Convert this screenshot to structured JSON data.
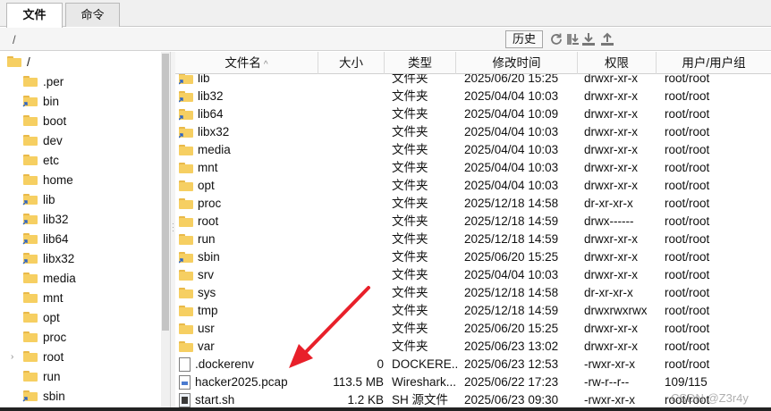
{
  "tabs": [
    {
      "label": "文件",
      "active": true
    },
    {
      "label": "命令",
      "active": false
    }
  ],
  "path": {
    "value": "/"
  },
  "toolbar": {
    "history_label": "历史",
    "icons": [
      "refresh-icon",
      "download-icon",
      "upload-icon"
    ]
  },
  "tree": {
    "root_label": "/",
    "items": [
      {
        "label": ".per"
      },
      {
        "label": "bin",
        "link": true
      },
      {
        "label": "boot"
      },
      {
        "label": "dev"
      },
      {
        "label": "etc"
      },
      {
        "label": "home"
      },
      {
        "label": "lib",
        "link": true
      },
      {
        "label": "lib32",
        "link": true
      },
      {
        "label": "lib64",
        "link": true
      },
      {
        "label": "libx32",
        "link": true
      },
      {
        "label": "media"
      },
      {
        "label": "mnt"
      },
      {
        "label": "opt"
      },
      {
        "label": "proc"
      },
      {
        "label": "root",
        "expandable": true
      },
      {
        "label": "run"
      },
      {
        "label": "sbin",
        "link": true
      }
    ]
  },
  "table": {
    "columns": {
      "name": "文件名",
      "size": "大小",
      "type": "类型",
      "mtime": "修改时间",
      "perm": "权限",
      "owner": "用户/用户组"
    },
    "rows": [
      {
        "name": "lib",
        "icon": "folder-link",
        "size": "",
        "type": "文件夹",
        "mtime": "2025/06/20 15:25",
        "perm": "drwxr-xr-x",
        "owner": "root/root"
      },
      {
        "name": "lib32",
        "icon": "folder-link",
        "size": "",
        "type": "文件夹",
        "mtime": "2025/04/04 10:03",
        "perm": "drwxr-xr-x",
        "owner": "root/root"
      },
      {
        "name": "lib64",
        "icon": "folder-link",
        "size": "",
        "type": "文件夹",
        "mtime": "2025/04/04 10:09",
        "perm": "drwxr-xr-x",
        "owner": "root/root"
      },
      {
        "name": "libx32",
        "icon": "folder-link",
        "size": "",
        "type": "文件夹",
        "mtime": "2025/04/04 10:03",
        "perm": "drwxr-xr-x",
        "owner": "root/root"
      },
      {
        "name": "media",
        "icon": "folder",
        "size": "",
        "type": "文件夹",
        "mtime": "2025/04/04 10:03",
        "perm": "drwxr-xr-x",
        "owner": "root/root"
      },
      {
        "name": "mnt",
        "icon": "folder",
        "size": "",
        "type": "文件夹",
        "mtime": "2025/04/04 10:03",
        "perm": "drwxr-xr-x",
        "owner": "root/root"
      },
      {
        "name": "opt",
        "icon": "folder",
        "size": "",
        "type": "文件夹",
        "mtime": "2025/04/04 10:03",
        "perm": "drwxr-xr-x",
        "owner": "root/root"
      },
      {
        "name": "proc",
        "icon": "folder",
        "size": "",
        "type": "文件夹",
        "mtime": "2025/12/18 14:58",
        "perm": "dr-xr-xr-x",
        "owner": "root/root"
      },
      {
        "name": "root",
        "icon": "folder",
        "size": "",
        "type": "文件夹",
        "mtime": "2025/12/18 14:59",
        "perm": "drwx------",
        "owner": "root/root"
      },
      {
        "name": "run",
        "icon": "folder",
        "size": "",
        "type": "文件夹",
        "mtime": "2025/12/18 14:59",
        "perm": "drwxr-xr-x",
        "owner": "root/root"
      },
      {
        "name": "sbin",
        "icon": "folder-link",
        "size": "",
        "type": "文件夹",
        "mtime": "2025/06/20 15:25",
        "perm": "drwxr-xr-x",
        "owner": "root/root"
      },
      {
        "name": "srv",
        "icon": "folder",
        "size": "",
        "type": "文件夹",
        "mtime": "2025/04/04 10:03",
        "perm": "drwxr-xr-x",
        "owner": "root/root"
      },
      {
        "name": "sys",
        "icon": "folder",
        "size": "",
        "type": "文件夹",
        "mtime": "2025/12/18 14:58",
        "perm": "dr-xr-xr-x",
        "owner": "root/root"
      },
      {
        "name": "tmp",
        "icon": "folder",
        "size": "",
        "type": "文件夹",
        "mtime": "2025/12/18 14:59",
        "perm": "drwxrwxrwx",
        "owner": "root/root"
      },
      {
        "name": "usr",
        "icon": "folder",
        "size": "",
        "type": "文件夹",
        "mtime": "2025/06/20 15:25",
        "perm": "drwxr-xr-x",
        "owner": "root/root"
      },
      {
        "name": "var",
        "icon": "folder",
        "size": "",
        "type": "文件夹",
        "mtime": "2025/06/23 13:02",
        "perm": "drwxr-xr-x",
        "owner": "root/root"
      },
      {
        "name": ".dockerenv",
        "icon": "file",
        "size": "0",
        "type": "DOCKERE...",
        "mtime": "2025/06/23 12:53",
        "perm": "-rwxr-xr-x",
        "owner": "root/root"
      },
      {
        "name": "hacker2025.pcap",
        "icon": "pcap",
        "size": "113.5 MB",
        "type": "Wireshark...",
        "mtime": "2025/06/22 17:23",
        "perm": "-rw-r--r--",
        "owner": "109/115"
      },
      {
        "name": "start.sh",
        "icon": "sh",
        "size": "1.2 KB",
        "type": "SH 源文件",
        "mtime": "2025/06/23 09:30",
        "perm": "-rwxr-xr-x",
        "owner": "root/root"
      }
    ]
  },
  "annotation": {
    "arrow_color": "#e8202a"
  },
  "watermark": "CSDN @Z3r4y",
  "colors": {
    "folder": "#f6cf62",
    "arrow": "#e8202a"
  }
}
